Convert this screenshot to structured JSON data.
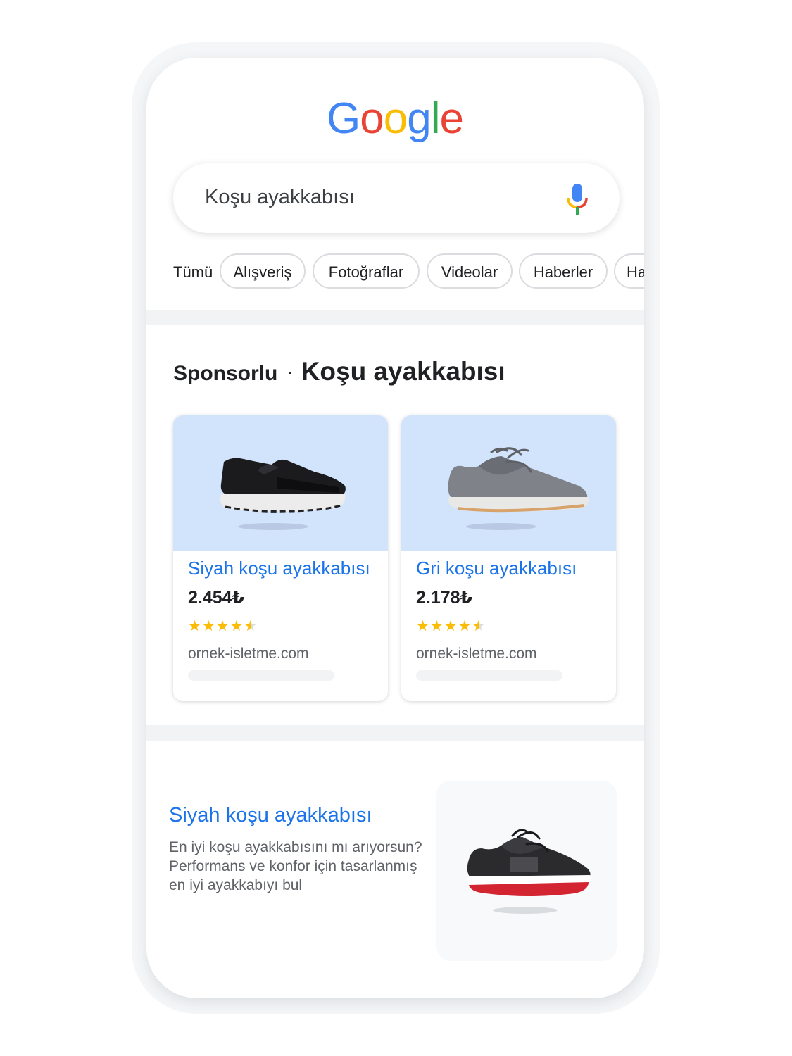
{
  "logo": {
    "text": "Google",
    "letters": [
      "G",
      "o",
      "o",
      "g",
      "l",
      "e"
    ],
    "colors": [
      "#4285F4",
      "#EA4335",
      "#FBBC05",
      "#4285F4",
      "#34A853",
      "#EA4335"
    ]
  },
  "search": {
    "query": "Koşu ayakkabısı",
    "icon": "mic-icon"
  },
  "tabs": {
    "plain": "Tümü",
    "items": [
      "Alışveriş",
      "Fotoğraflar",
      "Videolar",
      "Haberler",
      "Haritalar"
    ]
  },
  "sponsored": {
    "label": "Sponsorlu",
    "separator": "·",
    "title": "Koşu ayakkabısı"
  },
  "products": [
    {
      "title": "Siyah koşu ayakkabısı",
      "price": "2.454₺",
      "rating": 4.5,
      "stars_full": "★★★★",
      "stars_half": "★",
      "domain": "ornek-isletme.com",
      "image": "black-running-shoe"
    },
    {
      "title": "Gri koşu ayakkabısı",
      "price": "2.178₺",
      "rating": 4.5,
      "stars_full": "★★★★",
      "stars_half": "★",
      "domain": "ornek-isletme.com",
      "image": "gray-running-shoe"
    }
  ],
  "result": {
    "title": "Siyah koşu ayakkabısı",
    "description": "En iyi koşu ayakkabısını mı arıyorsun? Performans ve konfor için tasarlanmış en iyi ayakkabıyı bul",
    "image": "black-red-running-shoe"
  },
  "colors": {
    "link": "#1a73e8",
    "star": "#fbbc04",
    "card_image_bg": "#d2e3fc"
  }
}
